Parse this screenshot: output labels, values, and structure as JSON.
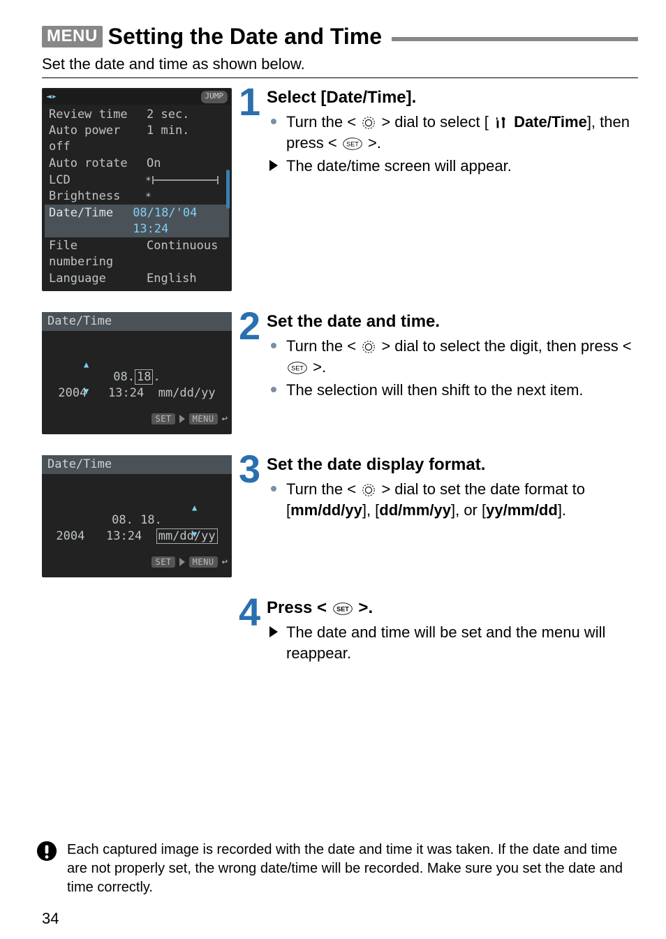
{
  "title_badge": "MENU",
  "title": "Setting the Date and Time",
  "intro": "Set the date and time as shown below.",
  "page_number": "34",
  "lcd_menu": {
    "jump": "JUMP",
    "rows": [
      {
        "label": "Review time",
        "value": "2 sec."
      },
      {
        "label": "Auto power off",
        "value": "1 min."
      },
      {
        "label": "Auto rotate",
        "value": "On"
      },
      {
        "label": "LCD Brightness",
        "value": ""
      },
      {
        "label": "Date/Time",
        "value": "08/18/'04 13:24"
      },
      {
        "label": "File numbering",
        "value": "Continuous"
      },
      {
        "label": "Language",
        "value": "English"
      }
    ]
  },
  "lcd_dt_header": "Date/Time",
  "lcd_dt1": {
    "date": "08.",
    "day": "18",
    "year": ". 2004",
    "time": "13:24",
    "fmt": "mm/dd/yy",
    "set": "SET",
    "menu": "MENU"
  },
  "lcd_dt2": {
    "date": "08. 18. 2004",
    "time": "13:24",
    "fmt": "mm/dd/yy",
    "set": "SET",
    "menu": "MENU"
  },
  "steps": [
    {
      "num": "1",
      "title": "Select [Date/Time].",
      "bullets": [
        {
          "type": "dot",
          "parts": [
            "Turn the <",
            "DIAL",
            "> dial to select [",
            "WRENCH",
            " ",
            "BOLD:Date/Time",
            "], then press <",
            "SET",
            ">."
          ]
        },
        {
          "type": "tri",
          "parts": [
            "The date/time screen will appear."
          ]
        }
      ]
    },
    {
      "num": "2",
      "title": "Set the date and time.",
      "bullets": [
        {
          "type": "dot",
          "parts": [
            "Turn the <",
            "DIAL",
            "> dial to select the digit, then press <",
            "SET",
            ">."
          ]
        },
        {
          "type": "dot",
          "parts": [
            "The selection will then shift to the next item."
          ]
        }
      ]
    },
    {
      "num": "3",
      "title": "Set the date display format.",
      "bullets": [
        {
          "type": "dot",
          "parts": [
            "Turn the <",
            "DIAL",
            "> dial to set the date format to [",
            "BOLD:mm/dd/yy",
            "], [",
            "BOLD:dd/mm/yy",
            "], or [",
            "BOLD:yy/mm/dd",
            "]."
          ]
        }
      ]
    },
    {
      "num": "4",
      "title_parts": [
        "Press <",
        "SET",
        ">."
      ],
      "bullets": [
        {
          "type": "tri",
          "parts": [
            "The date and time will be set and the menu will reappear."
          ]
        }
      ]
    }
  ],
  "note": "Each captured image is recorded with the date and time it was taken. If the date and time are not properly set, the wrong date/time will be recorded. Make sure you set the date and time correctly."
}
